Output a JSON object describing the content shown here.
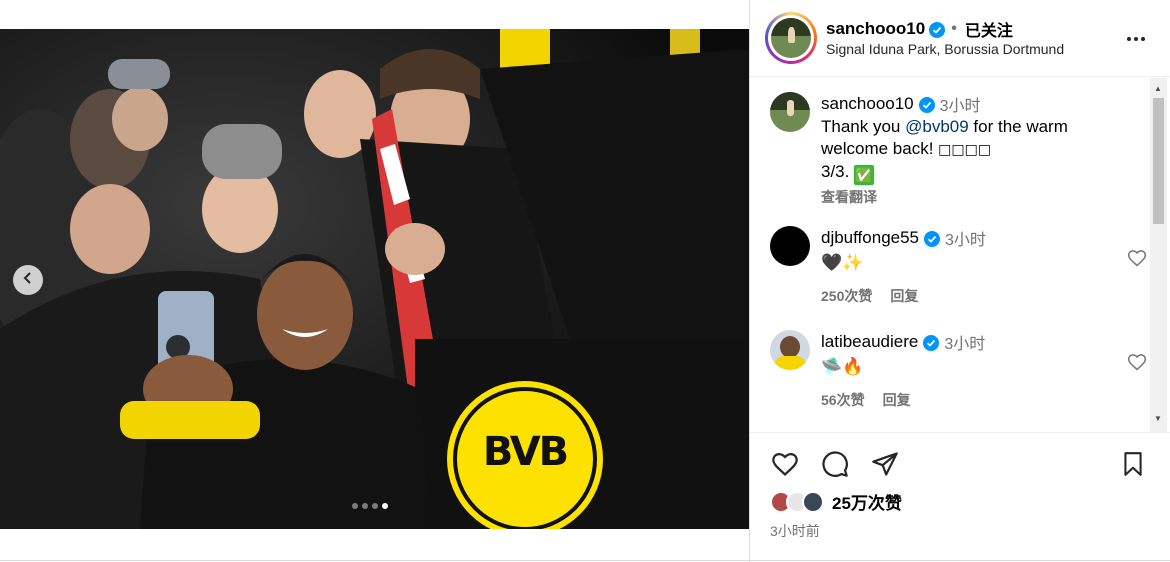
{
  "post": {
    "username": "sanchooo10",
    "follow_status": "已关注",
    "separator": "•",
    "location": "Signal Iduna Park, Borussia Dortmund",
    "photo_banner_text": "BVB",
    "carousel": {
      "total": 4,
      "active_index": 3
    }
  },
  "caption": {
    "username": "sanchooo10",
    "time": "3小时",
    "text_before": "Thank you ",
    "mention": "@bvb09",
    "text_after": " for the warm welcome back! ",
    "emoji_boxes": "□□□□",
    "line2": "3/3. ",
    "check_emoji": "✅",
    "translate": "查看翻译"
  },
  "comments": [
    {
      "username": "djbuffonge55",
      "time": "3小时",
      "text": "🖤✨",
      "likes": "250次赞",
      "reply": "回复"
    },
    {
      "username": "latibeaudiere",
      "time": "3小时",
      "text": "🛸🔥",
      "likes": "56次赞",
      "reply": "回复"
    }
  ],
  "footer": {
    "likes": "25万次赞",
    "time": "3小时前"
  },
  "icons": [
    "chevron-left-icon",
    "more-icon",
    "verified-icon",
    "heart-icon",
    "comment-icon",
    "share-icon",
    "bookmark-icon"
  ],
  "colors": {
    "verified": "#0095f6",
    "mention": "#00376b",
    "muted": "#737373",
    "bvb_yellow": "#fde100"
  }
}
